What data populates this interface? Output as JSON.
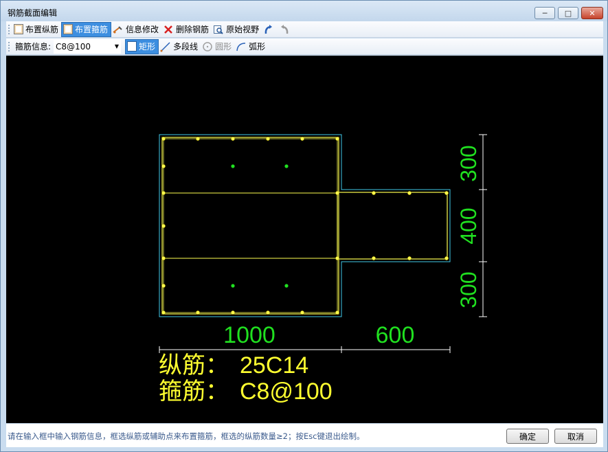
{
  "window": {
    "title": "钢筋截面编辑"
  },
  "toolbar1": {
    "items": [
      {
        "label": "布置纵筋",
        "icon": "rect-icon",
        "active": false
      },
      {
        "label": "布置箍筋",
        "icon": "rect-icon",
        "active": true
      },
      {
        "label": "信息修改",
        "icon": "edit-icon",
        "active": false
      },
      {
        "label": "删除钢筋",
        "icon": "delete-icon",
        "active": false
      },
      {
        "label": "原始视野",
        "icon": "view-icon",
        "active": false
      }
    ],
    "undo_icon": "undo-icon",
    "redo_icon": "redo-icon"
  },
  "toolbar2": {
    "stirrup_label": "箍筋信息:",
    "stirrup_value": "C8@100",
    "shapes": [
      {
        "label": "矩形",
        "icon": "rect-shape-icon",
        "active": true,
        "enabled": true
      },
      {
        "label": "多段线",
        "icon": "polyline-icon",
        "active": false,
        "enabled": true
      },
      {
        "label": "圆形",
        "icon": "circle-icon",
        "active": false,
        "enabled": false
      },
      {
        "label": "弧形",
        "icon": "arc-icon",
        "active": false,
        "enabled": false
      }
    ]
  },
  "drawing": {
    "dim_width_main": "1000",
    "dim_width_side": "600",
    "dim_heights": [
      "300",
      "400",
      "300"
    ],
    "long_bar_label": "纵筋：",
    "long_bar_value": "25C14",
    "stirrup_text_label": "箍筋：",
    "stirrup_text_value": "C8@100",
    "colors": {
      "outline": "#40c8e8",
      "stirrup": "#ffff50",
      "bar": "#ffff50",
      "aux_point": "#20e020",
      "dimension": "#20e020",
      "dim_line": "#ffffff",
      "text": "#ffff30"
    }
  },
  "status": {
    "message": "请在输入框中输入钢筋信息，框选纵筋或辅助点来布置箍筋，框选的纵筋数量≥2；按Esc键退出绘制。",
    "ok_label": "确定",
    "cancel_label": "取消"
  }
}
